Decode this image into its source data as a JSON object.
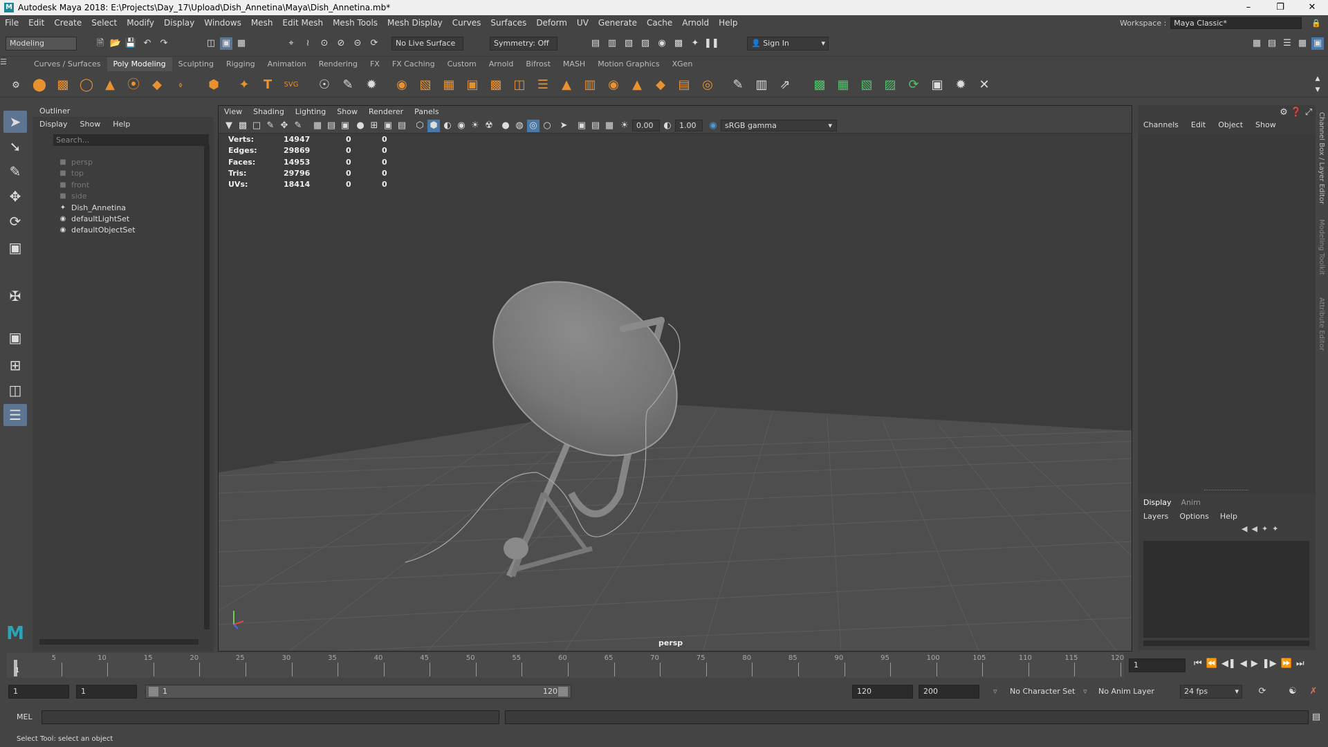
{
  "app": {
    "title": "Autodesk Maya 2018: E:\\Projects\\Day_17\\Upload\\Dish_Annetina\\Maya\\Dish_Annetina.mb*",
    "logo": "M"
  },
  "menubar": [
    "File",
    "Edit",
    "Create",
    "Select",
    "Modify",
    "Display",
    "Windows",
    "Mesh",
    "Edit Mesh",
    "Mesh Tools",
    "Mesh Display",
    "Curves",
    "Surfaces",
    "Deform",
    "UV",
    "Generate",
    "Cache",
    "Arnold",
    "Help"
  ],
  "workspace": {
    "label": "Workspace :",
    "value": "Maya Classic*"
  },
  "status": {
    "menuset": "Modeling",
    "live_surface": "No Live Surface",
    "symmetry": "Symmetry: Off",
    "sign_in": "Sign In"
  },
  "shelf_tabs": [
    {
      "label": "Curves / Surfaces"
    },
    {
      "label": "Poly Modeling",
      "active": true
    },
    {
      "label": "Sculpting"
    },
    {
      "label": "Rigging"
    },
    {
      "label": "Animation"
    },
    {
      "label": "Rendering"
    },
    {
      "label": "FX"
    },
    {
      "label": "FX Caching"
    },
    {
      "label": "Custom"
    },
    {
      "label": "Arnold"
    },
    {
      "label": "Bifrost"
    },
    {
      "label": "MASH"
    },
    {
      "label": "Motion Graphics"
    },
    {
      "label": "XGen"
    }
  ],
  "outliner": {
    "title": "Outliner",
    "menu": [
      "Display",
      "Show",
      "Help"
    ],
    "search_placeholder": "Search...",
    "items": [
      {
        "label": "persp",
        "icon": "camera-icon",
        "dim": true
      },
      {
        "label": "top",
        "icon": "camera-icon",
        "dim": true
      },
      {
        "label": "front",
        "icon": "camera-icon",
        "dim": true
      },
      {
        "label": "side",
        "icon": "camera-icon",
        "dim": true
      },
      {
        "label": "Dish_Annetina",
        "icon": "transform-icon",
        "dim": false
      },
      {
        "label": "defaultLightSet",
        "icon": "set-icon",
        "dim": false
      },
      {
        "label": "defaultObjectSet",
        "icon": "set-icon",
        "dim": false
      }
    ]
  },
  "viewport": {
    "menu": [
      "View",
      "Shading",
      "Lighting",
      "Show",
      "Renderer",
      "Panels"
    ],
    "exposure": "0.00",
    "gamma": "1.00",
    "color_space": "sRGB gamma",
    "camera_label": "persp",
    "hud": [
      {
        "label": "Verts:",
        "a": "14947",
        "b": "0",
        "c": "0"
      },
      {
        "label": "Edges:",
        "a": "29869",
        "b": "0",
        "c": "0"
      },
      {
        "label": "Faces:",
        "a": "14953",
        "b": "0",
        "c": "0"
      },
      {
        "label": "Tris:",
        "a": "29796",
        "b": "0",
        "c": "0"
      },
      {
        "label": "UVs:",
        "a": "18414",
        "b": "0",
        "c": "0"
      }
    ]
  },
  "channelbox": {
    "menu": [
      "Channels",
      "Edit",
      "Object",
      "Show"
    ],
    "layer_tabs": [
      "Display",
      "Anim"
    ],
    "layer_menu": [
      "Layers",
      "Options",
      "Help"
    ],
    "side_tabs": [
      "Channel Box / Layer Editor",
      "Modeling Toolkit",
      "Attribute Editor"
    ]
  },
  "timeline": {
    "ticks": [
      "5",
      "10",
      "15",
      "20",
      "25",
      "30",
      "35",
      "40",
      "45",
      "50",
      "55",
      "60",
      "65",
      "70",
      "75",
      "80",
      "85",
      "90",
      "95",
      "100",
      "105",
      "110",
      "115",
      "120"
    ],
    "current_frame": "1",
    "current_field": "1"
  },
  "range": {
    "start": "1",
    "playback_start": "1",
    "slider_start": "1",
    "slider_end": "120",
    "playback_end": "120",
    "end": "200",
    "character_set": "No Character Set",
    "anim_layer": "No Anim Layer",
    "fps": "24 fps"
  },
  "commandline": {
    "label": "MEL"
  },
  "helpline": "Select Tool: select an object"
}
